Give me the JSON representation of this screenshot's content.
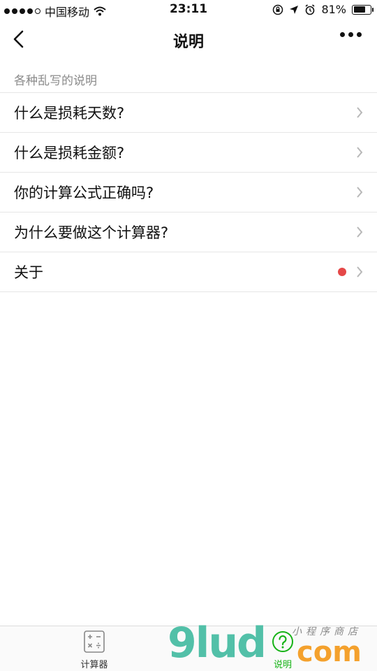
{
  "status_bar": {
    "carrier": "中国移动",
    "time": "23:11",
    "battery": "81%",
    "battery_level": 0.81
  },
  "nav": {
    "title": "说明"
  },
  "section": {
    "title": "各种乱写的说明"
  },
  "items": [
    {
      "label": "什么是损耗天数?",
      "badge": false
    },
    {
      "label": "什么是损耗金额?",
      "badge": false
    },
    {
      "label": "你的计算公式正确吗?",
      "badge": false
    },
    {
      "label": "为什么要做这个计算器?",
      "badge": false
    },
    {
      "label": "关于",
      "badge": true
    }
  ],
  "tabbar": {
    "tabs": [
      {
        "label": "计算器",
        "icon": "calculator-icon",
        "active": false
      },
      {
        "label": "说明",
        "icon": "question-icon",
        "active": true
      }
    ]
  },
  "watermark": {
    "main": "9lud",
    "suffix": "com",
    "sub": "小程序商店"
  },
  "colors": {
    "active_tab": "#17b317",
    "badge": "#e54848"
  }
}
